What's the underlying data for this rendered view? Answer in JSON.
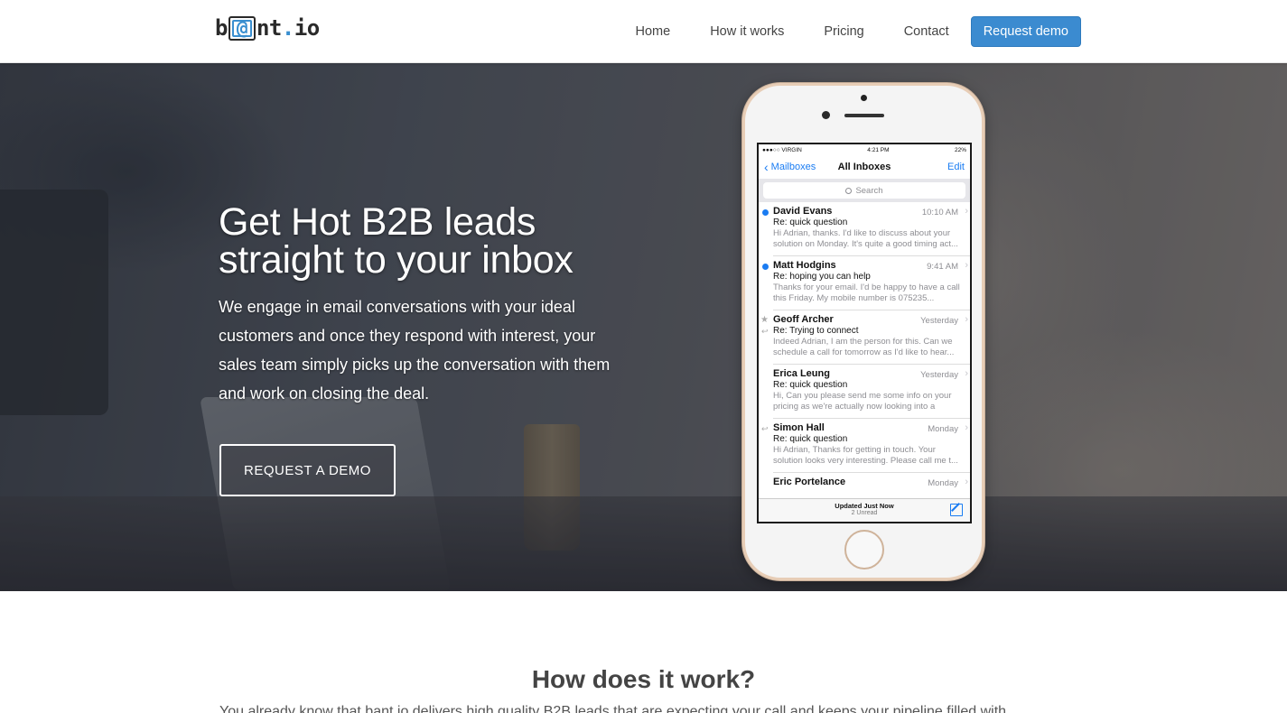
{
  "brand": {
    "logo_prefix": "b",
    "logo_at": "@",
    "logo_middle": "nt",
    "logo_dot": ".",
    "logo_suffix": "io",
    "accent": "#3b8bd0"
  },
  "nav": {
    "items": [
      {
        "label": "Home"
      },
      {
        "label": "How it works"
      },
      {
        "label": "Pricing"
      },
      {
        "label": "Contact"
      }
    ],
    "cta_label": "Request demo"
  },
  "hero": {
    "title": "Get Hot B2B leads straight to your inbox",
    "text": "We engage in email conversations with your ideal customers and once they respond with interest, your sales team simply picks up the conversation with them and work on closing the deal.",
    "button_label": "REQUEST A DEMO"
  },
  "phone": {
    "status": {
      "carrier": "●●●○○ VIRGIN",
      "time": "4:21 PM",
      "battery": "22%"
    },
    "back_label": "Mailboxes",
    "title": "All Inboxes",
    "edit_label": "Edit",
    "search_placeholder": "Search",
    "mails": [
      {
        "sender": "David Evans",
        "time": "10:10 AM",
        "subject": "Re: quick question",
        "preview": "Hi Adrian, thanks. I'd like to discuss about your solution on Monday. It's quite a good timing act..."
      },
      {
        "sender": "Matt Hodgins",
        "time": "9:41 AM",
        "subject": "Re: hoping you can help",
        "preview": "Thanks for your email. I'd be happy to have a call this Friday. My mobile number is 075235..."
      },
      {
        "sender": "Geoff Archer",
        "time": "Yesterday",
        "subject": "Re: Trying to connect",
        "preview": "Indeed Adrian, I am the person for this. Can we schedule a call for tomorrow as I'd like to hear..."
      },
      {
        "sender": "Erica Leung",
        "time": "Yesterday",
        "subject": "Re: quick question",
        "preview": "Hi, Can you please send me some info on your pricing as we're actually now looking into a"
      },
      {
        "sender": "Simon Hall",
        "time": "Monday",
        "subject": "Re: quick question",
        "preview": "Hi Adrian, Thanks for getting in touch. Your solution looks very interesting. Please call me t..."
      },
      {
        "sender": "Eric Portelance",
        "time": "Monday"
      }
    ],
    "updated": "Updated Just Now",
    "unread": "2 Unread"
  },
  "how": {
    "title": "How does it work?",
    "text": "You already know that bant.io delivers high quality B2B leads that are expecting your call and keeps your pipeline filled with"
  }
}
